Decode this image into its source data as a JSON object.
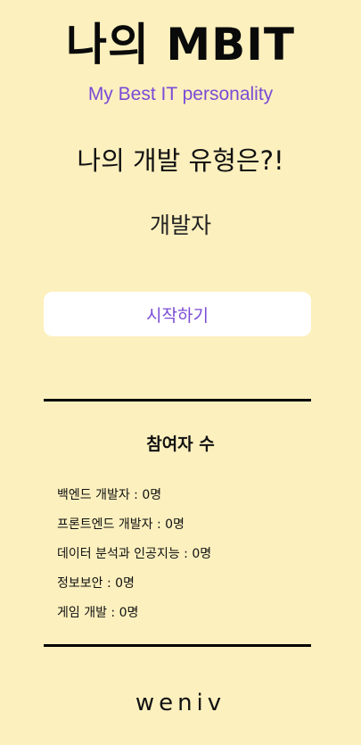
{
  "header": {
    "title": "나의 MBIT",
    "subtitle": "My Best IT personality"
  },
  "main": {
    "question": "나의 개발 유형은?!",
    "result": "개발자",
    "start_button_label": "시작하기"
  },
  "participants": {
    "title": "참여자 수",
    "items": [
      {
        "label": "백엔드 개발자 : 0명"
      },
      {
        "label": "프론트엔드 개발자 : 0명"
      },
      {
        "label": "데이터 분석과 인공지능 : 0명"
      },
      {
        "label": "정보보안 : 0명"
      },
      {
        "label": "게임 개발 : 0명"
      }
    ]
  },
  "footer": {
    "logo_text": "weniv"
  },
  "colors": {
    "background": "#fcf0be",
    "accent": "#7a4bd6",
    "button_bg": "#ffffff",
    "text": "#111111"
  }
}
